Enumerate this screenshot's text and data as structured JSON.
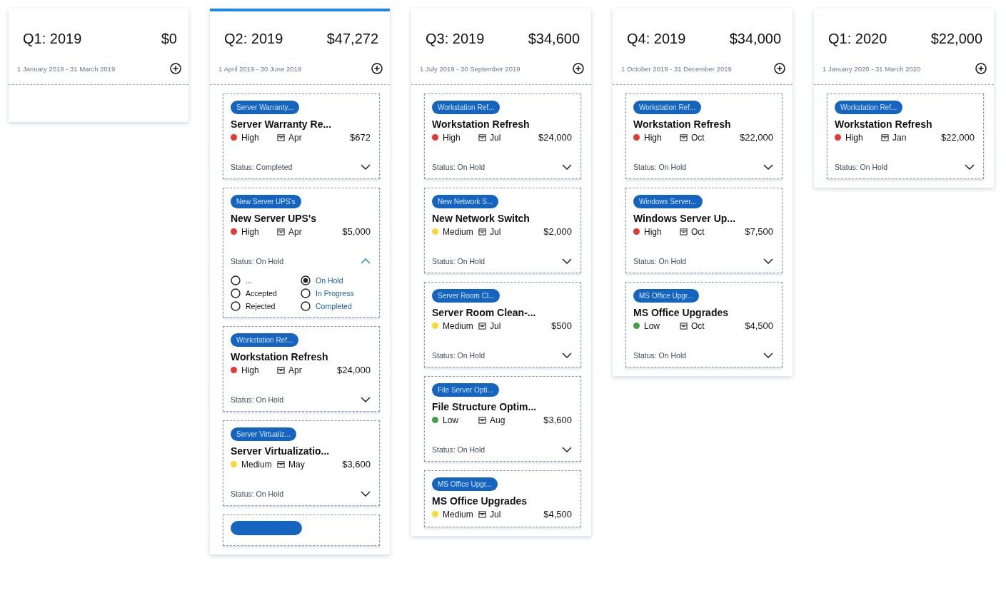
{
  "columns": [
    {
      "title": "Q1: 2019",
      "total": "$0",
      "dates": "1 January 2019 - 31 March 2019",
      "selected": false
    },
    {
      "title": "Q2: 2019",
      "total": "$47,272",
      "dates": "1 April 2019 - 30 June 2019",
      "selected": true,
      "cards": [
        {
          "tag": "Server Warranty...",
          "title": "Server Warranty Re...",
          "priority": "High",
          "color": "#e53935",
          "month": "Apr",
          "amount": "$672",
          "status": "Status: Completed",
          "expanded": false
        },
        {
          "tag": "New Server UPS's",
          "title": "New Server UPS's",
          "priority": "High",
          "color": "#e53935",
          "month": "Apr",
          "amount": "$5,000",
          "status": "Status: On Hold",
          "expanded": true,
          "options": [
            {
              "label": "...",
              "selected": false
            },
            {
              "label": "On Hold",
              "selected": true
            },
            {
              "label": "Accepted",
              "selected": false
            },
            {
              "label": "In Progress",
              "selected": false
            },
            {
              "label": "Rejected",
              "selected": false
            },
            {
              "label": "Completed",
              "selected": false
            }
          ]
        },
        {
          "tag": "Workstation Ref...",
          "title": "Workstation Refresh",
          "priority": "High",
          "color": "#e53935",
          "month": "Apr",
          "amount": "$24,000",
          "status": "Status: On Hold",
          "expanded": false
        },
        {
          "tag": "Server Virtualiz...",
          "title": "Server Virtualizatio...",
          "priority": "Medium",
          "color": "#fdd835",
          "month": "May",
          "amount": "$3,600",
          "status": "Status: On Hold",
          "expanded": false
        },
        {
          "kind": "partial"
        }
      ]
    },
    {
      "title": "Q3: 2019",
      "total": "$34,600",
      "dates": "1 July 2019 - 30 September 2019",
      "selected": false,
      "cards": [
        {
          "tag": "Workstation Ref...",
          "title": "Workstation Refresh",
          "priority": "High",
          "color": "#e53935",
          "month": "Jul",
          "amount": "$24,000",
          "status": "Status: On Hold",
          "expanded": false
        },
        {
          "tag": "New Network S...",
          "title": "New Network Switch",
          "priority": "Medium",
          "color": "#fdd835",
          "month": "Jul",
          "amount": "$2,000",
          "status": "Status: On Hold",
          "expanded": false
        },
        {
          "tag": "Server Room Cl...",
          "title": "Server Room Clean-...",
          "priority": "Medium",
          "color": "#fdd835",
          "month": "Jul",
          "amount": "$500",
          "status": "Status: On Hold",
          "expanded": false
        },
        {
          "tag": "File Server Opti...",
          "title": "File Structure Optim...",
          "priority": "Low",
          "color": "#43a047",
          "month": "Aug",
          "amount": "$3,600",
          "status": "Status: On Hold",
          "expanded": false
        },
        {
          "tag": "MS Office Upgr...",
          "title": "MS Office Upgrades",
          "priority": "Medium",
          "color": "#fdd835",
          "month": "Jul",
          "amount": "$4,500",
          "expanded": false
        }
      ]
    },
    {
      "title": "Q4: 2019",
      "total": "$34,000",
      "dates": "1 October 2019 - 31 December 2019",
      "selected": false,
      "cards": [
        {
          "tag": "Workstation Ref...",
          "title": "Workstation Refresh",
          "priority": "High",
          "color": "#e53935",
          "month": "Oct",
          "amount": "$22,000",
          "status": "Status: On Hold",
          "expanded": false
        },
        {
          "tag": "Windows Server...",
          "title": "Windows Server Up...",
          "priority": "High",
          "color": "#e53935",
          "month": "Oct",
          "amount": "$7,500",
          "status": "Status: On Hold",
          "expanded": false
        },
        {
          "tag": "MS Office Upgr...",
          "title": "MS Office Upgrades",
          "priority": "Low",
          "color": "#43a047",
          "month": "Oct",
          "amount": "$4,500",
          "status": "Status: On Hold",
          "expanded": false
        }
      ]
    },
    {
      "title": "Q1: 2020",
      "total": "$22,000",
      "dates": "1 January 2020 - 31 March 2020",
      "selected": false,
      "cards": [
        {
          "tag": "Workstation Ref...",
          "title": "Workstation Refresh",
          "priority": "High",
          "color": "#e53935",
          "month": "Jan",
          "amount": "$22,000",
          "status": "Status: On Hold",
          "expanded": false
        }
      ]
    }
  ]
}
